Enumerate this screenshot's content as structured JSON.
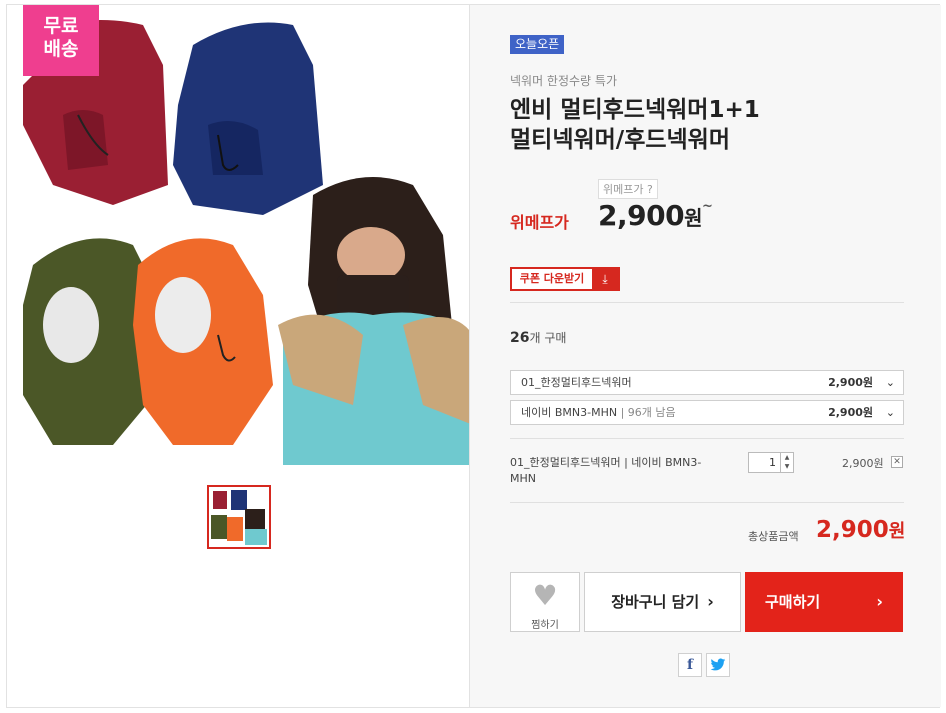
{
  "badge": {
    "line1": "무료",
    "line2": "배송"
  },
  "product": {
    "tag": "오늘오픈",
    "subtitle": "넥워머 한정수량 특가",
    "title_line1": "엔비 멀티후드넥워머1+1",
    "title_line2": "멀티넥워머/후드넥워머",
    "price_tag": "위메프가 ?",
    "price_label": "위메프가",
    "price": "2,900",
    "price_unit": "원",
    "price_suffix": "~"
  },
  "coupon": {
    "label": "쿠폰 다운받기",
    "icon": "download-icon"
  },
  "purchase": {
    "count": "26",
    "count_unit": "개 구매"
  },
  "options": [
    {
      "label": "01_한정멀티후드넥워머",
      "stock": "",
      "price": "2,900원"
    },
    {
      "label": "네이비 BMN3-MHN",
      "stock": "| 96개 남음",
      "price": "2,900원"
    }
  ],
  "selected": {
    "name": "01_한정멀티후드넥워머 | 네이비 BMN3-MHN",
    "qty": "1",
    "price": "2,900원",
    "remove_icon": "close-icon"
  },
  "total": {
    "label": "총상품금액",
    "price": "2,900",
    "unit": "원"
  },
  "buttons": {
    "wish": "찜하기",
    "cart": "장바구니 담기",
    "buy": "구매하기"
  },
  "share": {
    "facebook": "f",
    "twitter": "t"
  },
  "colors": {
    "accent": "#e3231a",
    "tag": "#3f63c7",
    "badge": "#ef3e8f"
  }
}
